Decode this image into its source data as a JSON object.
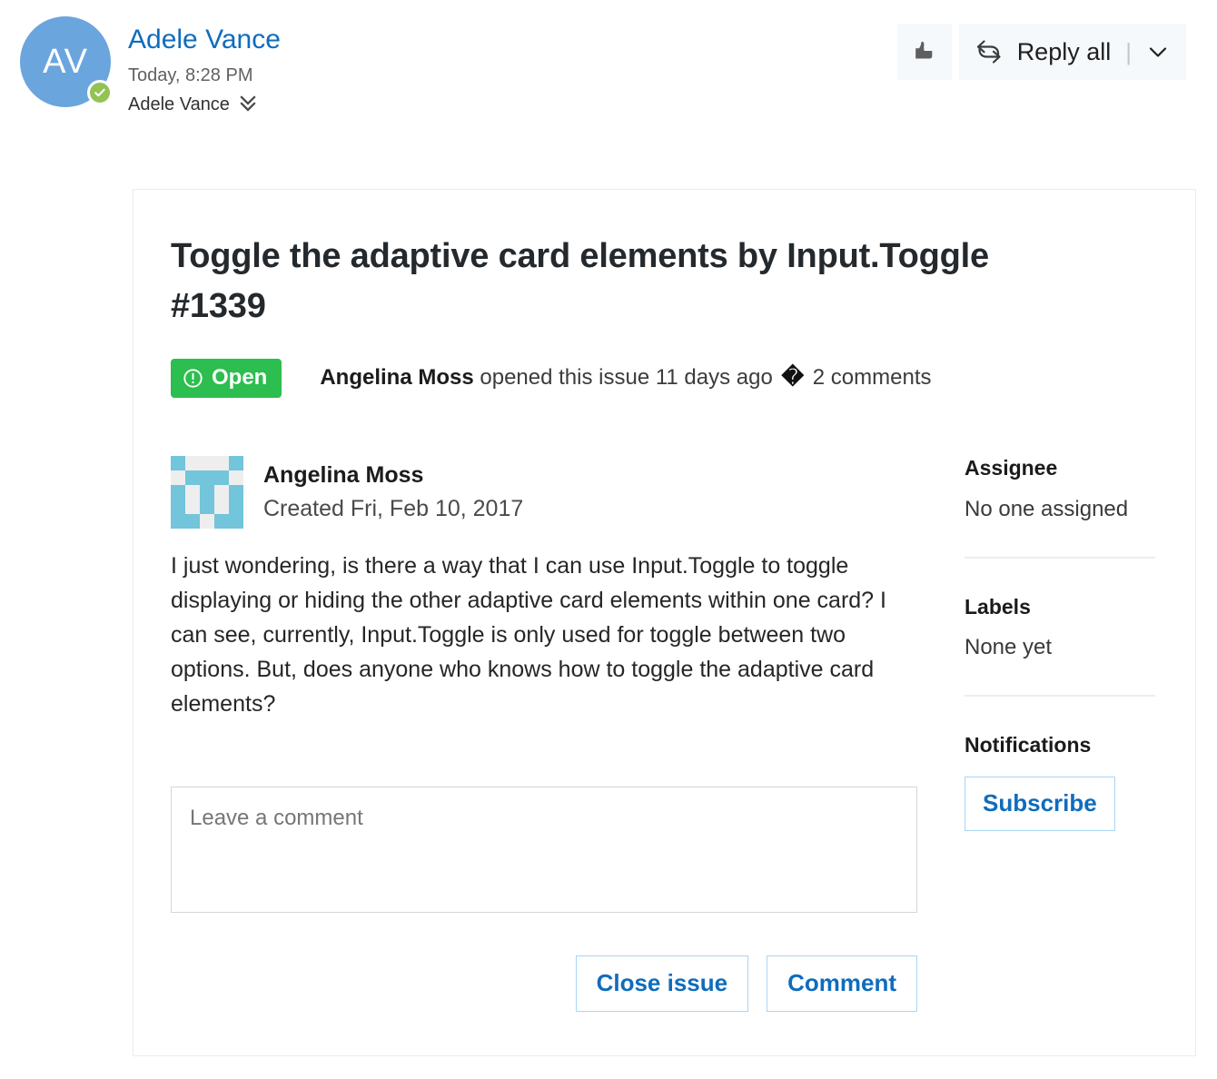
{
  "mail": {
    "sender": {
      "initials": "AV",
      "name": "Adele Vance",
      "timestamp": "Today, 8:28 PM",
      "presence": "available"
    },
    "recipients": "Adele Vance",
    "actions": {
      "like_label": "Like",
      "reply_all_label": "Reply all",
      "separator": "|"
    }
  },
  "issue": {
    "title": "Toggle the adaptive card elements by Input.Toggle #1339",
    "state_label": "Open",
    "meta": {
      "author": "Angelina Moss",
      "action_text": " opened this issue 11 days ago ",
      "separator": "�",
      "comments_count": " 2 comments"
    },
    "comment": {
      "author": "Angelina Moss",
      "created": "Created Fri, Feb 10, 2017",
      "body": "I just wondering, is there a way that I can use Input.Toggle to toggle displaying or hiding the other adaptive card elements within one card? I can see, currently, Input.Toggle is only used for toggle between two options. But, does anyone who knows how to toggle the adaptive card elements?"
    },
    "form": {
      "placeholder": "Leave a comment",
      "value": "",
      "close_label": "Close issue",
      "comment_label": "Comment"
    },
    "sidebar": {
      "assignee_title": "Assignee",
      "assignee_value": "No one assigned",
      "labels_title": "Labels",
      "labels_value": "None yet",
      "notifications_title": "Notifications",
      "subscribe_label": "Subscribe"
    }
  },
  "colors": {
    "link_blue": "#0f6cbd",
    "open_green": "#2cbe4e",
    "presence_green": "#92c353",
    "avatar_blue": "#6ba5de",
    "identicon_teal": "#72c5da",
    "button_border": "#a8d5f5"
  }
}
